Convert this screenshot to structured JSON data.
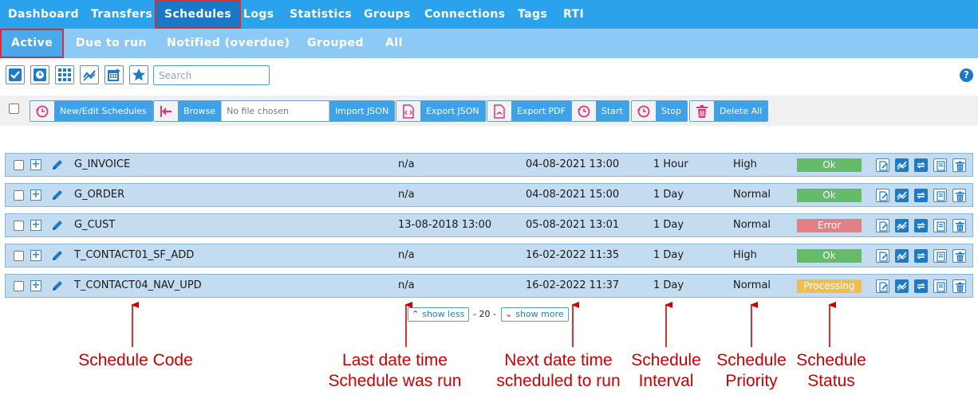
{
  "topnav": {
    "items": [
      "Dashboard",
      "Transfers",
      "Schedules",
      "Logs",
      "Statistics",
      "Groups",
      "Connections",
      "Tags",
      "RTI"
    ],
    "active": "Schedules"
  },
  "subnav": {
    "items": [
      "Active",
      "Due to run",
      "Notified (overdue)",
      "Grouped",
      "All"
    ],
    "active": "Active"
  },
  "toolbar": {
    "search_placeholder": "Search",
    "help": "?"
  },
  "actionbar": {
    "new_edit": "New/Edit Schedules",
    "browse": "Browse",
    "file_status": "No file chosen",
    "import": "Import JSON",
    "export_json": "Export JSON",
    "export_pdf": "Export PDF",
    "start": "Start",
    "stop": "Stop",
    "delete_all": "Delete All"
  },
  "rows": [
    {
      "code": "G_INVOICE",
      "last": "n/a",
      "next": "04-08-2021 13:00",
      "interval": "1 Hour",
      "priority": "High",
      "status": "Ok"
    },
    {
      "code": "G_ORDER",
      "last": "n/a",
      "next": "04-08-2021 15:00",
      "interval": "1 Day",
      "priority": "Normal",
      "status": "Ok"
    },
    {
      "code": "G_CUST",
      "last": "13-08-2018 13:00",
      "next": "05-08-2021 13:01",
      "interval": "1 Day",
      "priority": "Normal",
      "status": "Error"
    },
    {
      "code": "T_CONTACT01_SF_ADD",
      "last": "n/a",
      "next": "16-02-2022 11:35",
      "interval": "1 Day",
      "priority": "High",
      "status": "Ok"
    },
    {
      "code": "T_CONTACT04_NAV_UPD",
      "last": "n/a",
      "next": "16-02-2022 11:37",
      "interval": "1 Day",
      "priority": "Normal",
      "status": "Processing"
    }
  ],
  "status_colors": {
    "Ok": "#66bb6a",
    "Error": "#e57f86",
    "Processing": "#efbe52"
  },
  "pagination": {
    "show_less": "show less",
    "page_size": "- 20 -",
    "show_more": "show more"
  },
  "annotations": {
    "code": "Schedule Code",
    "last_line1": "Last date time",
    "last_line2": "Schedule was run",
    "next_line1": "Next date time",
    "next_line2": "scheduled to run",
    "interval_line1": "Schedule",
    "interval_line2": "Interval",
    "priority_line1": "Schedule",
    "priority_line2": "Priority",
    "status_line1": "Schedule",
    "status_line2": "Status"
  }
}
